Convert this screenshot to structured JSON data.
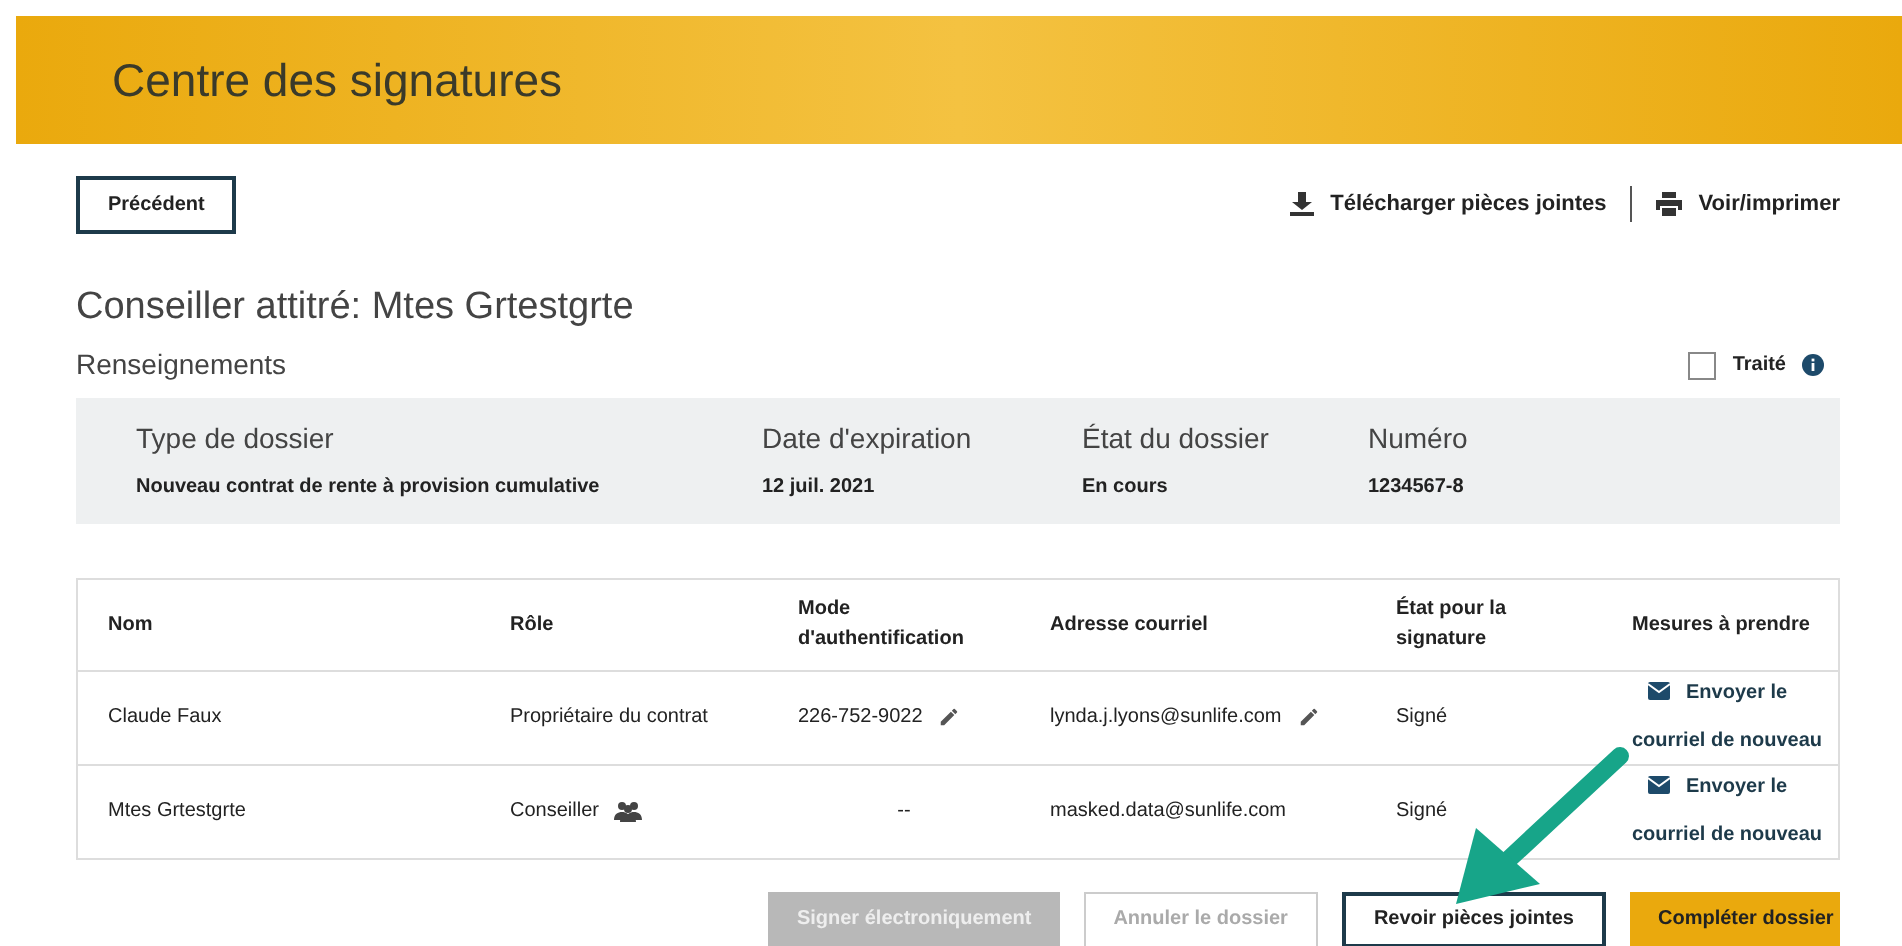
{
  "header": {
    "title": "Centre des signatures"
  },
  "toolbar": {
    "back_button": "Précédent",
    "links": [
      {
        "kind": "download",
        "label": "Télécharger pièces jointes"
      },
      {
        "kind": "print",
        "label": "Voir/imprimer"
      }
    ]
  },
  "advisor_title": "Conseiller attitré: Mtes Grtestgrte",
  "section_title": "Renseignements",
  "processed": {
    "label": "Traité",
    "checked": false
  },
  "summary": [
    {
      "label": "Type de dossier",
      "value": "Nouveau contrat de rente à provision cumulative"
    },
    {
      "label": "Date d'expiration",
      "value": "12 juil. 2021"
    },
    {
      "label": "État du dossier",
      "value": "En cours"
    },
    {
      "label": "Numéro",
      "value": "1234567-8"
    }
  ],
  "table": {
    "columns": [
      "Nom",
      "Rôle",
      "Mode d'authentification",
      "Adresse courriel",
      "État pour la signature",
      "Mesures à prendre"
    ],
    "rows": [
      {
        "name": "Claude Faux",
        "role": "Propriétaire du contrat",
        "role_icon": false,
        "auth": "226-752-9022",
        "auth_editable": true,
        "email": "lynda.j.lyons@sunlife.com",
        "email_editable": true,
        "status": "Signé",
        "action": "Envoyer le courriel de nouveau"
      },
      {
        "name": "Mtes Grtestgrte",
        "role": "Conseiller",
        "role_icon": true,
        "auth": "--",
        "auth_editable": false,
        "email": "masked.data@sunlife.com",
        "email_editable": false,
        "status": "Signé",
        "action": "Envoyer le courriel de nouveau"
      }
    ]
  },
  "buttons": [
    {
      "label": "Signer électroniquement",
      "kind": "filled-grey",
      "disabled": true
    },
    {
      "label": "Annuler le dossier",
      "kind": "outline",
      "disabled": true
    },
    {
      "label": "Revoir pièces jointes",
      "kind": "outline",
      "disabled": false
    },
    {
      "label": "Compléter dossier",
      "kind": "primary",
      "disabled": false
    }
  ]
}
